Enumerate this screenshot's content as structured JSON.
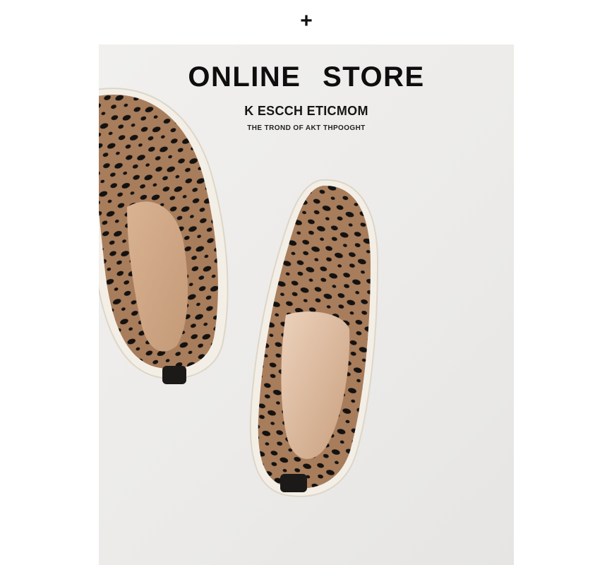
{
  "header": {
    "plus_icon": "plus-icon"
  },
  "banner": {
    "title": "ONLINE STORE",
    "subtitle": "K ESCCH ETICMOM",
    "tagline": "THE TROND OF AKT THPOOGHT"
  },
  "colors": {
    "background": "#ececea",
    "knit": "#a87d5c",
    "spots": "#141210",
    "insole": "#e2c3a7",
    "sole": "#f3efe6"
  }
}
